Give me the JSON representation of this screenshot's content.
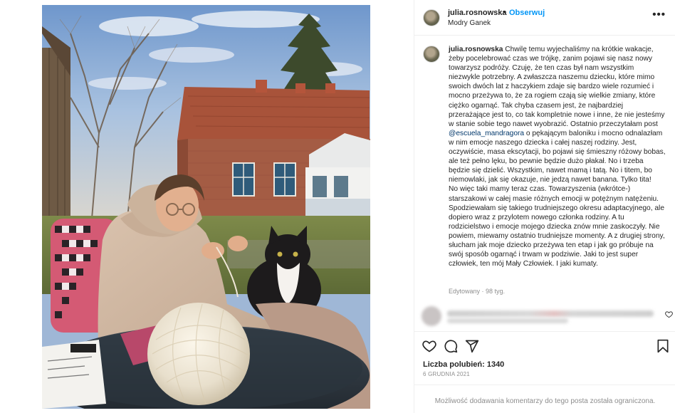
{
  "post": {
    "username": "julia.rosnowska",
    "dot": "•",
    "follow_label": "Obserwuj",
    "location": "Modry Ganek",
    "more_label": "•••"
  },
  "caption": {
    "username": "julia.rosnowska",
    "text_before_mention": "Chwilę temu wyjechaliśmy na krótkie wakacje, żeby pocelebrować czas we trójkę, zanim pojawi się nasz nowy towarzysz podróży. Czuję, że ten czas był nam wszystkim niezwykle potrzebny. A zwłaszcza naszemu dziecku, które mimo swoich dwóch lat z haczykiem zdaje się bardzo wiele rozumieć i mocno przeżywa to, że za rogiem czają się wielkie zmiany, które ciężko ogarnąć. Tak chyba czasem jest, że najbardziej przerażające jest to, co tak kompletnie nowe i inne, że nie jesteśmy w stanie sobie tego nawet wyobrazić. Ostatnio przeczytałam post ",
    "mention": "@escuela_mandragora",
    "text_after_mention": " o pękającym baloniku i mocno odnalazłam w nim emocje naszego dziecka i całej naszej rodziny. Jest, oczywiście, masa ekscytacji, bo pojawi się śmieszny różowy bobas, ale też pełno lęku, bo pewnie będzie dużo płakał. No i trzeba będzie się dzielić. Wszystkim, nawet mamą i tatą. No i titem, bo niemowlaki, jak się okazuje, nie jedzą nawet banana. Tylko tita!",
    "paragraph_2": "No więc taki mamy teraz czas. Towarzyszenia (wkrótce-) starszakowi w całej masie różnych emocji w potężnym natężeniu. Spodziewałam się takiego trudniejszego okresu adaptacyjnego, ale dopiero wraz z przylotem nowego członka rodziny. A tu rodzicielstwo i emocje mojego dziecka znów mnie zaskoczyły. Nie powiem, miewamy ostatnio trudniejsze momenty. A z drugiej strony, słucham jak moje dziecko przeżywa ten etap i jak go próbuje na swój sposób ogarnąć i trwam w podziwie. Jaki to jest super człowiek, ten mój Mały Człowiek. I jaki kumaty.",
    "edited_label": "Edytowany · 98 tyg."
  },
  "actions": {
    "icons": [
      "heart-icon",
      "comment-icon",
      "share-icon",
      "bookmark-icon"
    ]
  },
  "likes_label": "Liczba polubień: 1340",
  "date_label": "6 GRUDNIA 2021",
  "comments_limited": "Możliwość dodawania komentarzy do tego posta została ograniczona.",
  "colors": {
    "link_blue": "#0095f6",
    "mention_blue": "#00376b",
    "muted_gray": "#8e8e8e",
    "text": "#262626"
  }
}
